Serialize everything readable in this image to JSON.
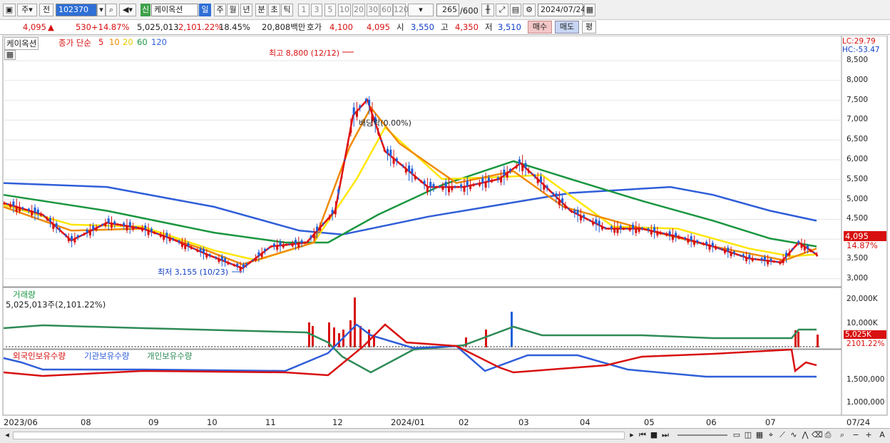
{
  "toolbar": {
    "market": "주",
    "prev_label": "전",
    "code": "102370",
    "name_badge": "신",
    "stock_name": "케이옥션",
    "periods": [
      "일",
      "주",
      "월",
      "년",
      "분",
      "초",
      "틱"
    ],
    "intervals": [
      "1",
      "3",
      "5",
      "10",
      "20",
      "30",
      "60",
      "120"
    ],
    "count": "265",
    "count_total": "/600",
    "date": "2024/07/24"
  },
  "quote": {
    "price": "4,095",
    "change": "530",
    "change_pct": "+14.87%",
    "volume": "5,025,013",
    "volume_ratio": "2,101.22%",
    "turnover": "18.45%",
    "amount": "20,808백만",
    "ask_label": "호가",
    "ask": "4,100",
    "bid": "4,095",
    "open_label": "시",
    "open": "3,550",
    "high_label": "고",
    "high": "4,350",
    "low_label": "저",
    "low": "3,510",
    "buy_label": "매수",
    "sell_label": "매도",
    "eval_label": "평"
  },
  "price_panel": {
    "stock_label": "케이옥션",
    "ma_label": "종가 단순",
    "ma_periods": [
      "5",
      "10",
      "20",
      "60",
      "120"
    ],
    "lc": "LC:29.79",
    "hc": "HC:-53.47",
    "high_note": "최고 8,800 (12/12)",
    "low_note": "최저 3,155 (10/23)",
    "dividend_note": "배당락(0.00%)",
    "last_price_tag": "4,095",
    "last_pct_tag": "14.87%",
    "y_ticks": [
      "8,500",
      "8,000",
      "7,500",
      "7,000",
      "6,500",
      "6,000",
      "5,500",
      "5,000",
      "4,500",
      "4,000",
      "3,500",
      "3,000"
    ]
  },
  "volume_panel": {
    "title": "거래량",
    "value": "5,025,013주(2,101.22%)",
    "y_ticks": [
      "20,000K",
      "10,000K"
    ],
    "last_tag": "5,025K",
    "last_pct": "2101.22%"
  },
  "holdings_panel": {
    "legend": [
      "외국인보유수량",
      "기관보유수량",
      "개인보유수량"
    ],
    "y_ticks": [
      "1,500,000",
      "1,000,000"
    ]
  },
  "x_axis": [
    "2023/06",
    "08",
    "09",
    "10",
    "11",
    "12",
    "2024/01",
    "02",
    "03",
    "04",
    "05",
    "06",
    "07"
  ],
  "x_axis_end": "07/24",
  "colors": {
    "ma5": "#e01010",
    "ma10": "#f08a00",
    "ma20": "#ffe600",
    "ma60": "#1a9640",
    "ma120": "#2f5ed8",
    "up": "#d81010",
    "down": "#1e5fd8",
    "foreign": "#d81010",
    "institution": "#2f5ed8",
    "individual": "#2e8b57"
  }
}
